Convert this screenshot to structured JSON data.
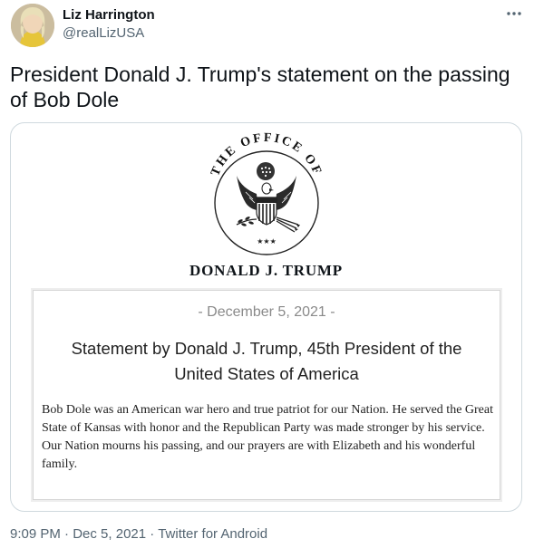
{
  "author": {
    "display_name": "Liz Harrington",
    "handle": "@realLizUSA"
  },
  "tweet": {
    "text": "President Donald J. Trump's statement on the passing of Bob Dole",
    "time": "9:09 PM",
    "date": "Dec 5, 2021",
    "source": "Twitter for Android",
    "separator": "·"
  },
  "card": {
    "arc_text": "THE OFFICE OF",
    "office_name": "DONALD J. TRUMP",
    "date_line": "- December 5, 2021 -",
    "headline": "Statement by Donald J. Trump, 45th President of the United States of America",
    "body": "Bob Dole was an American war hero and true patriot for our Nation. He served the Great State of Kansas with honor and the Republican Party was made stronger by his service. Our Nation mourns his passing, and our prayers are with Elizabeth and his wonderful family.",
    "seal_stars": "★★★"
  },
  "icons": {
    "more": "more-horizontal-icon",
    "seal": "eagle-seal-icon"
  },
  "colors": {
    "text_primary": "#0f1419",
    "text_secondary": "#536471",
    "border": "#cfd9de"
  }
}
